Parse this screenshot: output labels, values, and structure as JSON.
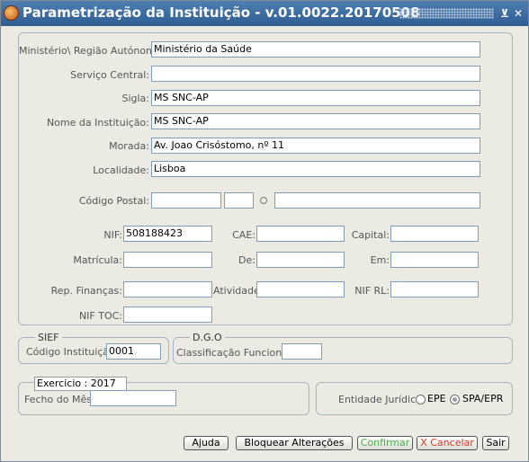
{
  "window": {
    "title": "Parametrização da Instituição - v.01.0022.20170508",
    "minimize_glyph": "⊻",
    "close_glyph": "✕"
  },
  "institution": {
    "ministerio_label": "Ministério\\ Região Autónoma:",
    "ministerio_value": "Ministério da Saúde",
    "servico_label": "Serviço Central:",
    "servico_value": "",
    "sigla_label": "Sigla:",
    "sigla_value": "MS SNC-AP",
    "nome_label": "Nome da Instituição:",
    "nome_value": "MS SNC-AP",
    "morada_label": "Morada:",
    "morada_value": "Av. Joao Crisóstomo, nº 11",
    "localidade_label": "Localidade:",
    "localidade_value": "Lisboa",
    "codigo_postal_label": "Código Postal:",
    "codigo_postal_value": "",
    "codigo_postal_ext": "",
    "codigo_postal_local": "",
    "nif_label": "NIF:",
    "nif_value": "508188423",
    "cae_label": "CAE:",
    "cae_value": "",
    "capital_label": "Capital:",
    "capital_value": "",
    "matricula_label": "Matrícula:",
    "matricula_value": "",
    "de_label": "De:",
    "de_value": "",
    "em_label": "Em:",
    "em_value": "",
    "rep_financas_label": "Rep. Finanças:",
    "rep_financas_value": "",
    "atividade_label": "Atividade",
    "atividade_value": "",
    "nif_rl_label": "NIF RL:",
    "nif_rl_value": "",
    "nif_toc_label": "NIF TOC:",
    "nif_toc_value": ""
  },
  "sief": {
    "legend": "SIEF",
    "codigo_label": "Código Instituição:",
    "codigo_value": "0001"
  },
  "dgo": {
    "legend": "D.G.O",
    "classificacao_label": "Classificação Funcional:",
    "classificacao_value": ""
  },
  "exercicio": {
    "legend": "Exercicio : 2017",
    "fecho_label": "Fecho do Mês:",
    "fecho_value": ""
  },
  "entidade": {
    "label": "Entidade Jurídica:",
    "options": [
      {
        "label": "EPE",
        "selected": false
      },
      {
        "label": "SPA/EPR",
        "selected": true
      }
    ]
  },
  "buttons": {
    "ajuda": "Ajuda",
    "bloquear": "Bloquear Alterações",
    "confirmar": "Confirmar",
    "cancelar": "X Cancelar",
    "sair": "Sair"
  },
  "colors": {
    "title_bar": "#2d5d92",
    "confirm_text": "#4caf50",
    "cancel_text": "#d93a2b",
    "background": "#ecebe3"
  }
}
